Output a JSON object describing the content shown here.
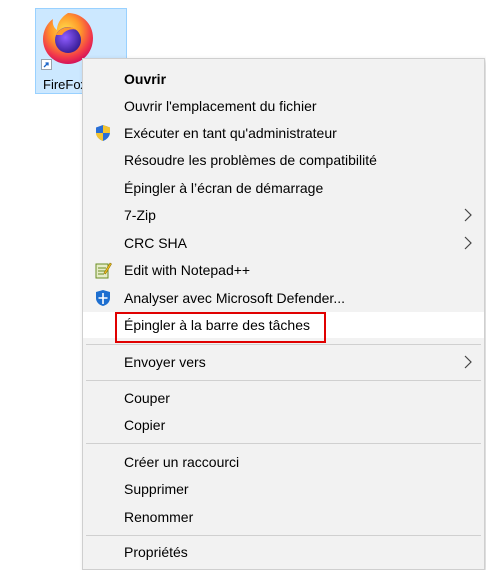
{
  "desktop_icon": {
    "label": "FireFox",
    "icon": "firefox-icon",
    "selected": true
  },
  "context_menu": {
    "items": [
      {
        "label": "Ouvrir",
        "bold": true
      },
      {
        "label": "Ouvrir l'emplacement du fichier"
      },
      {
        "label": "Exécuter en tant qu'administrateur",
        "icon": "uac-shield-icon"
      },
      {
        "label": "Résoudre les problèmes de compatibilité"
      },
      {
        "label": "Épingler à l’écran de démarrage"
      },
      {
        "label": "7-Zip",
        "submenu": true
      },
      {
        "label": "CRC SHA",
        "submenu": true
      },
      {
        "label": "Edit with Notepad++",
        "icon": "notepad-plus-plus-icon"
      },
      {
        "label": "Analyser avec Microsoft Defender...",
        "icon": "defender-shield-icon"
      },
      {
        "label": "Épingler à la barre des tâches",
        "highlighted": true
      },
      {
        "label": "Envoyer vers",
        "submenu": true
      },
      {
        "label": "Couper"
      },
      {
        "label": "Copier"
      },
      {
        "label": "Créer un raccourci"
      },
      {
        "label": "Supprimer"
      },
      {
        "label": "Renommer"
      },
      {
        "label": "Propriétés"
      }
    ]
  },
  "colors": {
    "menu_bg": "#f2f2f2",
    "selection_bg": "#cce8ff",
    "highlight_box": "#e00000"
  }
}
